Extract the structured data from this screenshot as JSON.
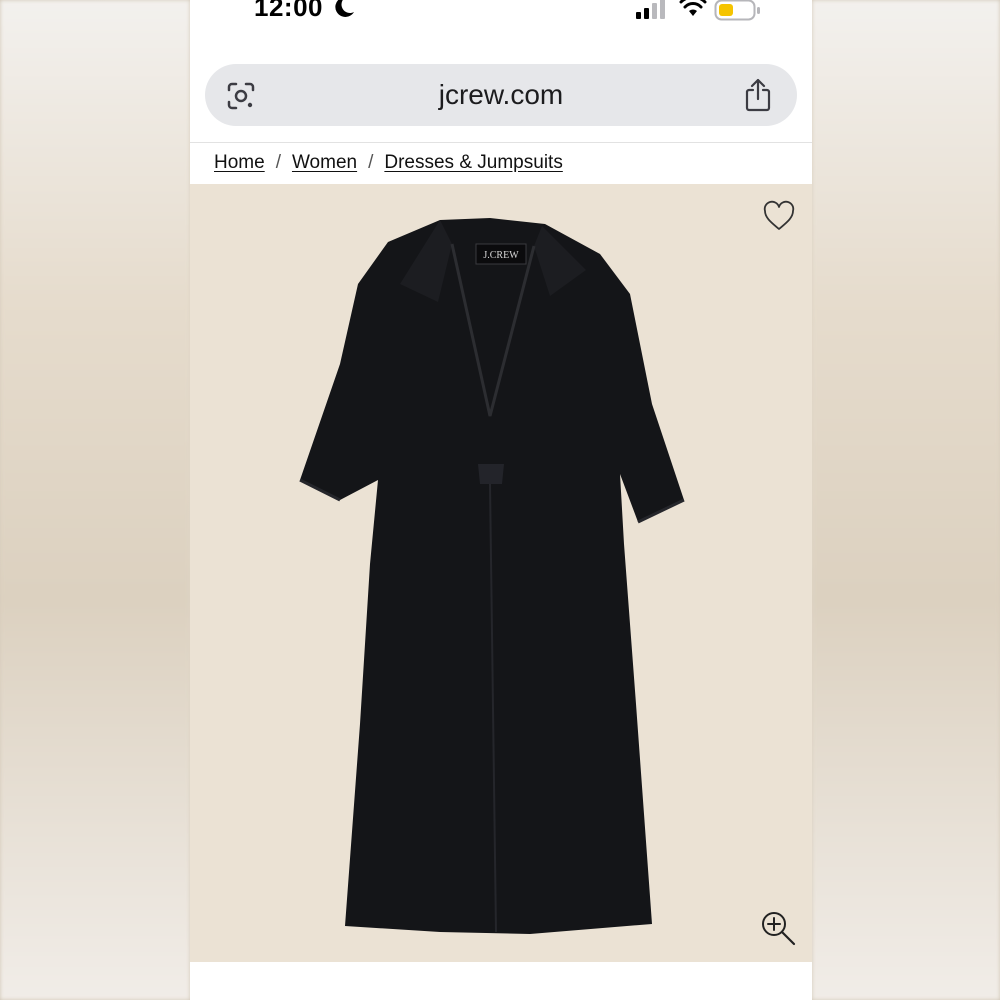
{
  "status_bar": {
    "time": "12:00",
    "icons": [
      "moon-icon",
      "cellular-signal-icon",
      "wifi-icon",
      "battery-icon"
    ],
    "battery_color": "#f5c400"
  },
  "address_bar": {
    "url": "jcrew.com",
    "left_icon": "google-lens-icon",
    "right_icon": "share-icon",
    "background": "#e6e7ea"
  },
  "breadcrumb": {
    "items": [
      {
        "label": "Home"
      },
      {
        "label": "Women"
      },
      {
        "label": "Dresses & Jumpsuits"
      }
    ],
    "separator": "/"
  },
  "product": {
    "image_subject": "black short-sleeve linen popover dress",
    "label_text": "J.CREW",
    "image_background": "#ebe2d4",
    "dress_color": "#141518",
    "icons": [
      "heart-icon",
      "zoom-in-icon"
    ]
  }
}
